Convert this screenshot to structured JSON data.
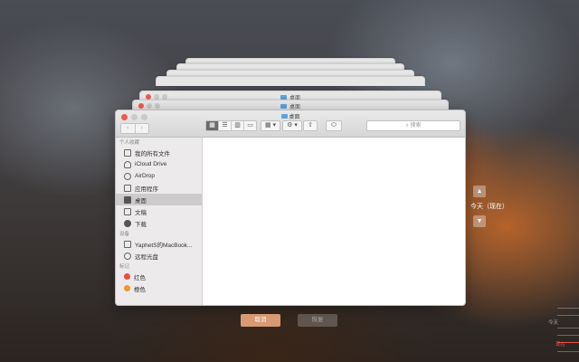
{
  "stack_windows": [
    {
      "title": ""
    },
    {
      "title": ""
    },
    {
      "title": ""
    },
    {
      "title": ""
    },
    {
      "title": "桌面"
    },
    {
      "title": "桌面"
    },
    {
      "title": "桌面"
    }
  ],
  "finder": {
    "toolbar": {
      "back": "‹",
      "forward": "›",
      "arrange_label": "▦ ▾",
      "action_label": "⚙ ▾",
      "share_label": "⇧",
      "tag_label": "⬭",
      "search_placeholder": "搜索"
    },
    "sidebar": {
      "favorites_header": "个人收藏",
      "favorites": [
        {
          "label": "我的所有文件",
          "icon": "all-files-icon"
        },
        {
          "label": "iCloud Drive",
          "icon": "cloud-icon"
        },
        {
          "label": "AirDrop",
          "icon": "airdrop-icon"
        },
        {
          "label": "应用程序",
          "icon": "applications-icon"
        },
        {
          "label": "桌面",
          "icon": "desktop-icon",
          "selected": true
        },
        {
          "label": "文稿",
          "icon": "documents-icon"
        },
        {
          "label": "下载",
          "icon": "downloads-icon"
        }
      ],
      "devices_header": "设备",
      "devices": [
        {
          "label": "YaphetS的MacBook...",
          "icon": "laptop-icon"
        },
        {
          "label": "远程光盘",
          "icon": "disc-icon"
        }
      ],
      "tags_header": "标记",
      "tags": [
        {
          "label": "红色",
          "color": "#ee4c40"
        },
        {
          "label": "橙色",
          "color": "#f0962a"
        }
      ]
    }
  },
  "time_machine": {
    "up_arrow": "▲",
    "down_arrow": "▼",
    "now_label": "今天（现在）",
    "timeline_today": "今天",
    "timeline_now": "现在"
  },
  "buttons": {
    "cancel": "取消",
    "restore": "恢复"
  }
}
